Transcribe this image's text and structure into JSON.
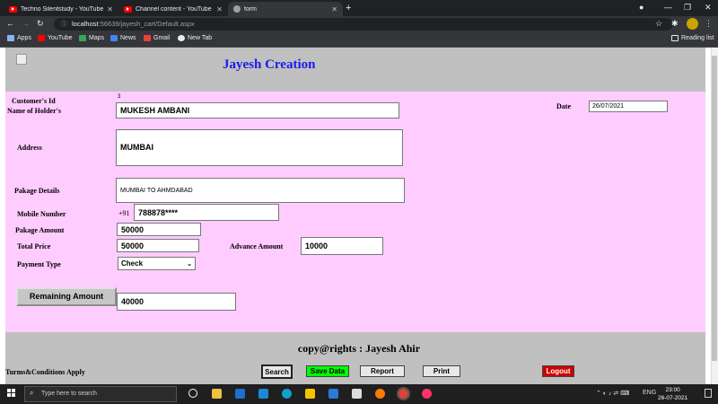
{
  "browser": {
    "tabs": [
      {
        "title": "Techno Silentstudy - YouTube",
        "favicon": "youtube-icon"
      },
      {
        "title": "Channel content - YouTube Studio",
        "favicon": "youtube-icon"
      },
      {
        "title": "form",
        "favicon": "globe-icon"
      }
    ],
    "url_host": "localhost",
    "url_path": ":56639/jayesh_cart/Default.aspx",
    "bookmarks": [
      "Apps",
      "YouTube",
      "Maps",
      "News",
      "Gmail",
      "New Tab"
    ],
    "reading_list": "Reading list"
  },
  "page": {
    "title": "Jayesh Creation",
    "customer_id_label": "Customer's Id",
    "customer_id_value": "3",
    "holder_label": "Name of Holder's",
    "holder_value": "MUKESH AMBANI",
    "date_label": "Date",
    "date_value": "26/07/2021",
    "address_label": "Address",
    "address_value": "MUMBAI",
    "package_details_label": "Pakage Details",
    "package_details_value": "MUMBAI TO AHMDABAD",
    "mobile_label": "Mobile Number",
    "mobile_prefix": "+91",
    "mobile_value": "788878****",
    "package_amount_label": "Pakage Amount",
    "package_amount_value": "50000",
    "total_price_label": "Total Price",
    "total_price_value": "50000",
    "advance_amount_label": "Advance Amount",
    "advance_amount_value": "10000",
    "payment_type_label": "Payment Type",
    "payment_type_value": "Check",
    "remaining_button": "Remaining Amount",
    "remaining_value": "40000",
    "copyright": "copy@rights : Jayesh Ahir",
    "terms": "Turms&Conditions Apply",
    "buttons": {
      "search": "Search",
      "save": "Save Data",
      "report": "Report",
      "print": "Print",
      "logout": "Logout"
    }
  },
  "taskbar": {
    "search_placeholder": "Type here to search",
    "lang": "ENG",
    "time": "23:00",
    "date": "26-07-2021"
  },
  "colors": {
    "header_band": "#c0c0c0",
    "form_band": "#ffccff",
    "title": "#1a1aee",
    "save_button": "#00ff00",
    "logout_button": "#cc0000"
  }
}
